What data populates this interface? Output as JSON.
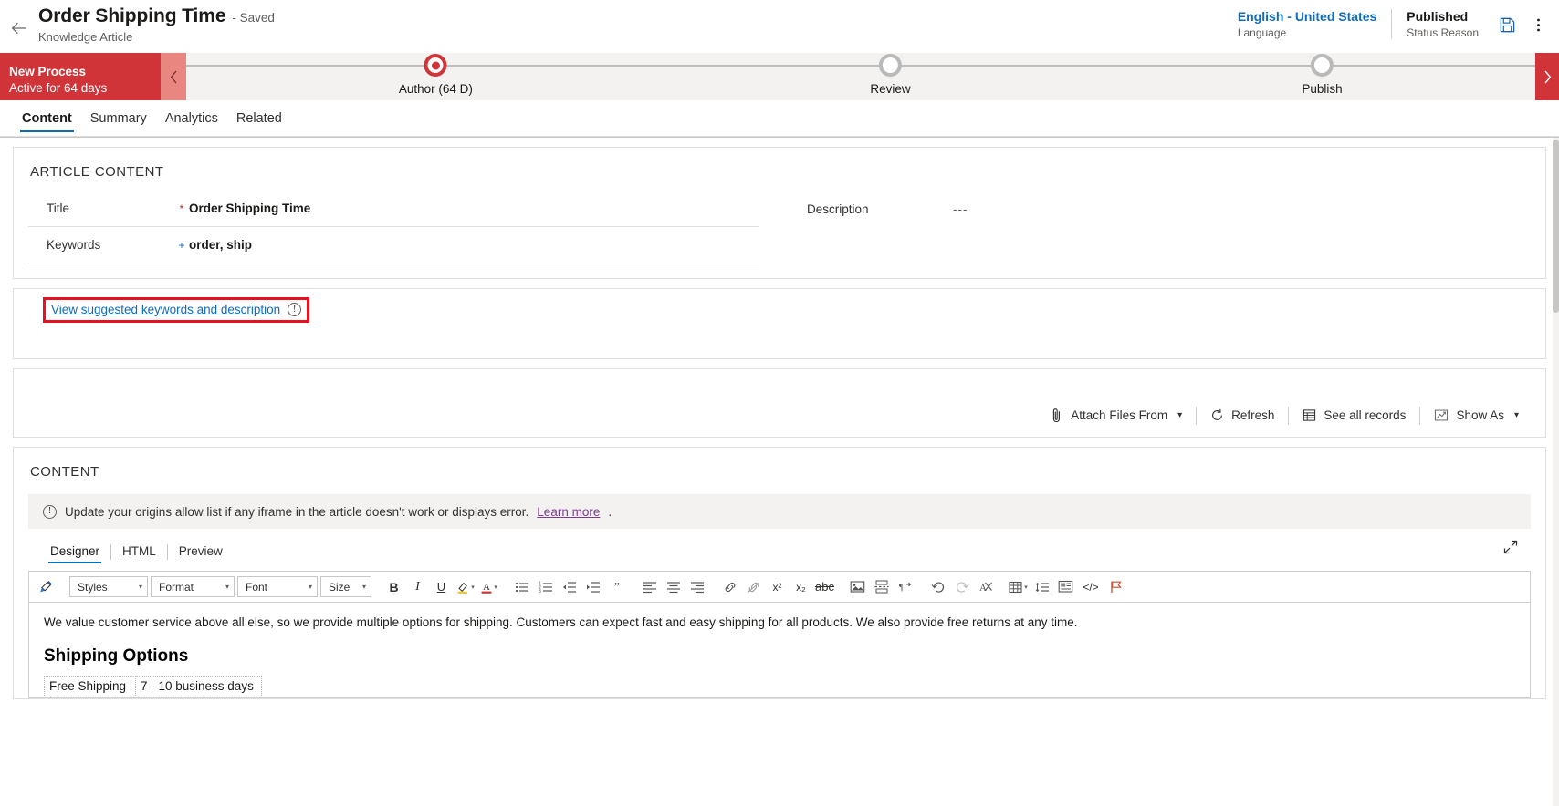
{
  "header": {
    "back_icon": "back-arrow-icon",
    "record_title": "Order Shipping Time",
    "save_state": "- Saved",
    "entity_name": "Knowledge Article",
    "language_value": "English - United States",
    "language_label": "Language",
    "status_value": "Published",
    "status_label": "Status Reason",
    "save_icon": "save-icon",
    "more_icon": "more-vertical-icon"
  },
  "process_flow": {
    "active_stage_title": "New Process",
    "active_stage_subtitle": "Active for 64 days",
    "collapse_icon": "chevron-left-icon",
    "next_icon": "chevron-right-icon",
    "stages": [
      {
        "label": "Author  (64 D)",
        "state": "current"
      },
      {
        "label": "Review",
        "state": "upcoming"
      },
      {
        "label": "Publish",
        "state": "upcoming"
      }
    ]
  },
  "tabs": [
    {
      "label": "Content",
      "active": true
    },
    {
      "label": "Summary",
      "active": false
    },
    {
      "label": "Analytics",
      "active": false
    },
    {
      "label": "Related",
      "active": false
    }
  ],
  "article_content": {
    "section_title": "ARTICLE CONTENT",
    "left_fields": [
      {
        "label": "Title",
        "required_mark": "*",
        "required_kind": "required",
        "value": "Order Shipping Time"
      },
      {
        "label": "Keywords",
        "required_mark": "+",
        "required_kind": "recommended",
        "value": "order, ship"
      }
    ],
    "right_fields": [
      {
        "label": "Description",
        "required_mark": "",
        "required_kind": "none",
        "value": "---"
      }
    ]
  },
  "suggestion": {
    "link_text": "View suggested keywords and description",
    "info_icon": "info-circle-icon",
    "info_glyph": "!",
    "highlight_color": "#e81123"
  },
  "attachments_toolbar": {
    "buttons": [
      {
        "label": "Attach Files From",
        "icon": "paperclip-icon",
        "has_caret": true
      },
      {
        "label": "Refresh",
        "icon": "refresh-icon",
        "has_caret": false
      },
      {
        "label": "See all records",
        "icon": "grid-records-icon",
        "has_caret": false
      },
      {
        "label": "Show As",
        "icon": "chart-view-icon",
        "has_caret": true
      }
    ]
  },
  "content_section": {
    "section_title": "CONTENT",
    "notice": {
      "icon": "info-circle-icon",
      "text": "Update your origins allow list if any iframe in the article doesn't work or displays error.",
      "link_text": "Learn more",
      "trailing": "."
    },
    "editor_tabs": [
      {
        "label": "Designer",
        "active": true
      },
      {
        "label": "HTML",
        "active": false
      },
      {
        "label": "Preview",
        "active": false
      }
    ],
    "expand_icon": "expand-diagonal-icon"
  },
  "rte_toolbar": {
    "format_painter_icon": "format-painter-icon",
    "combos": [
      {
        "name": "styles",
        "value": "Styles"
      },
      {
        "name": "format",
        "value": "Format"
      },
      {
        "name": "font",
        "value": "Font"
      },
      {
        "name": "size",
        "value": "Size"
      }
    ],
    "buttons": [
      {
        "name": "bold-button",
        "glyph": "B",
        "kind": "bold"
      },
      {
        "name": "italic-button",
        "glyph": "I",
        "kind": "ital"
      },
      {
        "name": "underline-button",
        "glyph": "U",
        "kind": "und"
      },
      {
        "name": "highlight-color-button",
        "glyph": "highlighter-icon",
        "kind": "svg-highlight",
        "caret": true
      },
      {
        "name": "font-color-button",
        "glyph": "font-color-icon",
        "kind": "svg-fontcolor",
        "caret": true
      },
      {
        "name": "bulleted-list-button",
        "glyph": "bullet-list-icon",
        "kind": "svg-ul"
      },
      {
        "name": "numbered-list-button",
        "glyph": "numbered-list-icon",
        "kind": "svg-ol"
      },
      {
        "name": "decrease-indent-button",
        "glyph": "decrease-indent-icon",
        "kind": "svg-outdent"
      },
      {
        "name": "increase-indent-button",
        "glyph": "increase-indent-icon",
        "kind": "svg-indent"
      },
      {
        "name": "blockquote-button",
        "glyph": "”",
        "kind": "quote"
      },
      {
        "name": "align-left-button",
        "glyph": "align-left-icon",
        "kind": "svg-al"
      },
      {
        "name": "align-center-button",
        "glyph": "align-center-icon",
        "kind": "svg-ac"
      },
      {
        "name": "align-right-button",
        "glyph": "align-right-icon",
        "kind": "svg-ar"
      },
      {
        "name": "insert-link-button",
        "glyph": "link-icon",
        "kind": "svg-link"
      },
      {
        "name": "remove-link-button",
        "glyph": "unlink-icon",
        "kind": "svg-unlink"
      },
      {
        "name": "superscript-button",
        "glyph": "x²",
        "kind": "sup"
      },
      {
        "name": "subscript-button",
        "glyph": "x₂",
        "kind": "sub"
      },
      {
        "name": "strikethrough-button",
        "glyph": "abc",
        "kind": "strike"
      },
      {
        "name": "insert-image-button",
        "glyph": "image-icon",
        "kind": "svg-img"
      },
      {
        "name": "page-break-button",
        "glyph": "page-break-icon",
        "kind": "svg-pagebreak"
      },
      {
        "name": "rtl-direction-button",
        "glyph": "rtl-icon",
        "kind": "svg-rtl"
      },
      {
        "name": "undo-button",
        "glyph": "undo-icon",
        "kind": "svg-undo"
      },
      {
        "name": "redo-button",
        "glyph": "redo-icon",
        "kind": "svg-redo"
      },
      {
        "name": "clear-format-button",
        "glyph": "clear-format-icon",
        "kind": "svg-clear"
      },
      {
        "name": "insert-table-button",
        "glyph": "table-icon",
        "kind": "svg-table",
        "caret": true
      },
      {
        "name": "line-height-button",
        "glyph": "line-height-icon",
        "kind": "svg-lineheight"
      },
      {
        "name": "insert-template-button",
        "glyph": "template-icon",
        "kind": "svg-template"
      },
      {
        "name": "source-code-button",
        "glyph": "</>",
        "kind": "code"
      },
      {
        "name": "flag-button",
        "glyph": "flag-icon",
        "kind": "svg-flag"
      }
    ]
  },
  "article_body": {
    "paragraph": "We value customer service above all else, so we provide multiple options for shipping. Customers can expect fast and easy shipping for all products. We also provide free returns at any time.",
    "heading": "Shipping Options",
    "table_rows": [
      {
        "option": "Free Shipping",
        "duration": "7 - 10 business days"
      }
    ]
  }
}
